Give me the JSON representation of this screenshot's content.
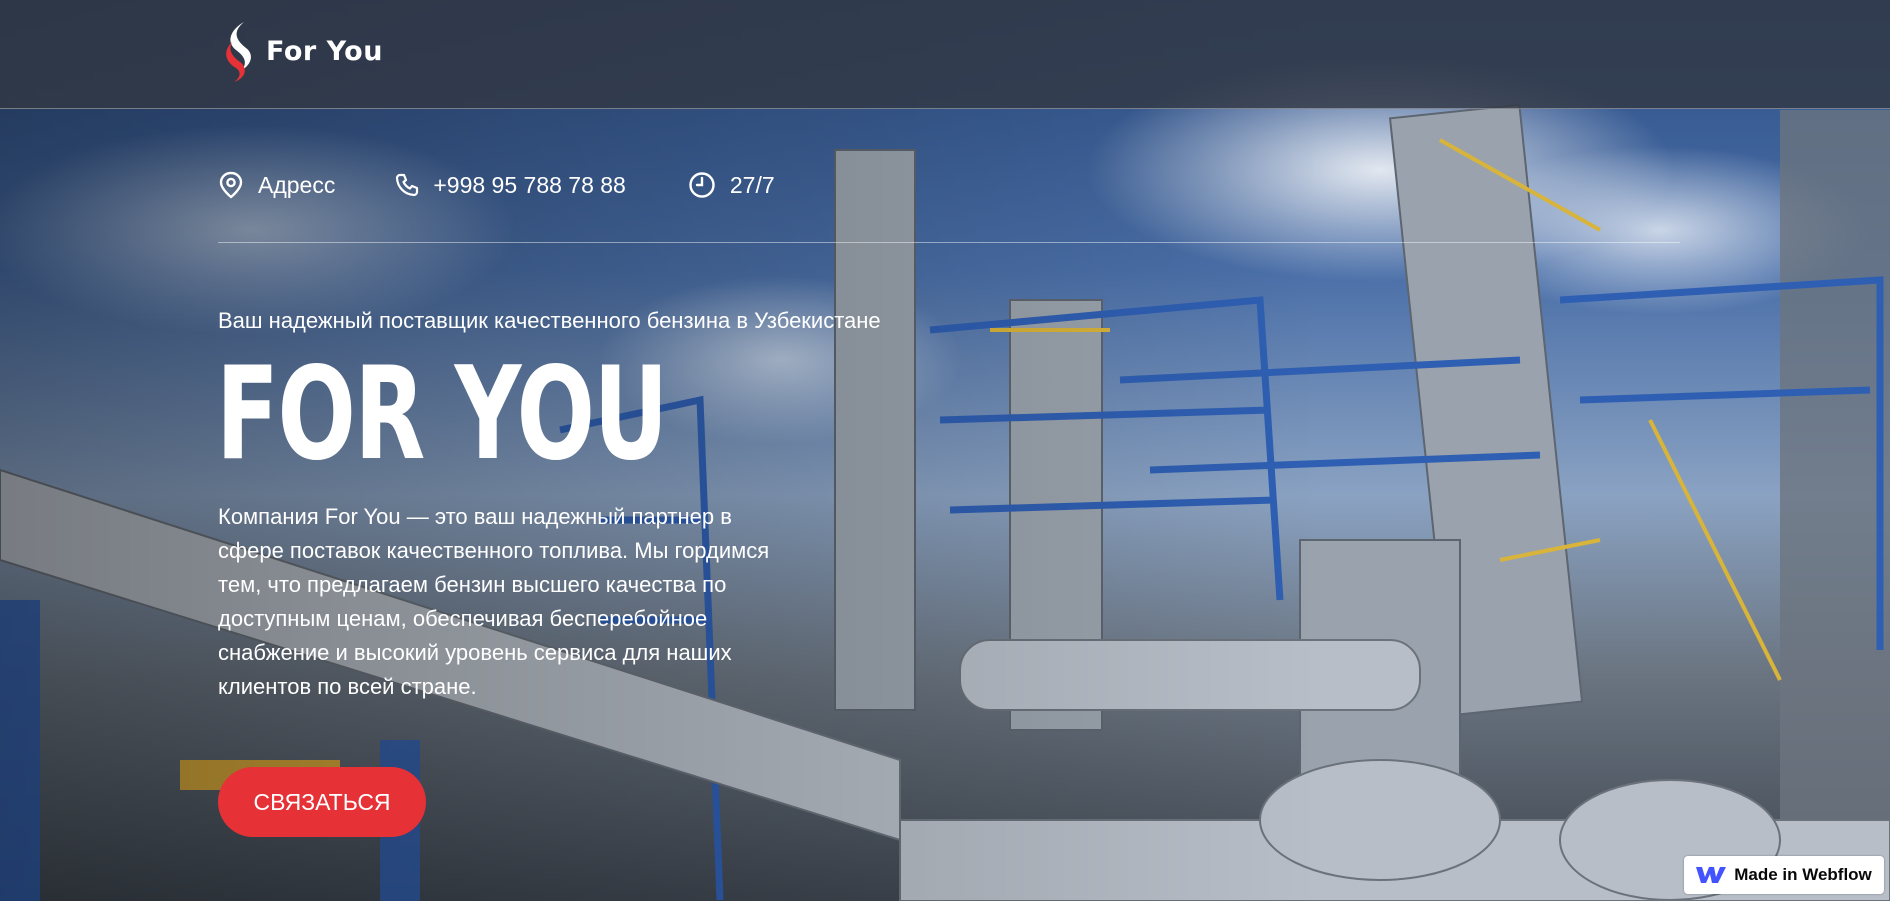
{
  "brand": {
    "name": "For You",
    "logo_icon": "flame-logo-icon"
  },
  "contacts": [
    {
      "icon": "location-pin-icon",
      "label": "Адресс"
    },
    {
      "icon": "phone-icon",
      "label": "+998 95 788 78 88"
    },
    {
      "icon": "clock-icon",
      "label": "27/7"
    }
  ],
  "hero": {
    "tagline": "Ваш надежный поставщик качественного бензина в Узбекистане",
    "title": "FOR YOU",
    "description": "Компания For You — это ваш надежный партнер в сфере поставок качественного топлива. Мы гордимся тем, что предлагаем бензин высшего качества по доступным ценам, обеспечивая бесперебойное снабжение и высокий уровень сервиса для наших клиентов по всей стране.",
    "cta_label": "СВЯЗАТЬСЯ"
  },
  "badge": {
    "label": "Made in Webflow",
    "icon": "webflow-icon"
  },
  "colors": {
    "accent": "#e63136",
    "navbar": "#323844"
  }
}
